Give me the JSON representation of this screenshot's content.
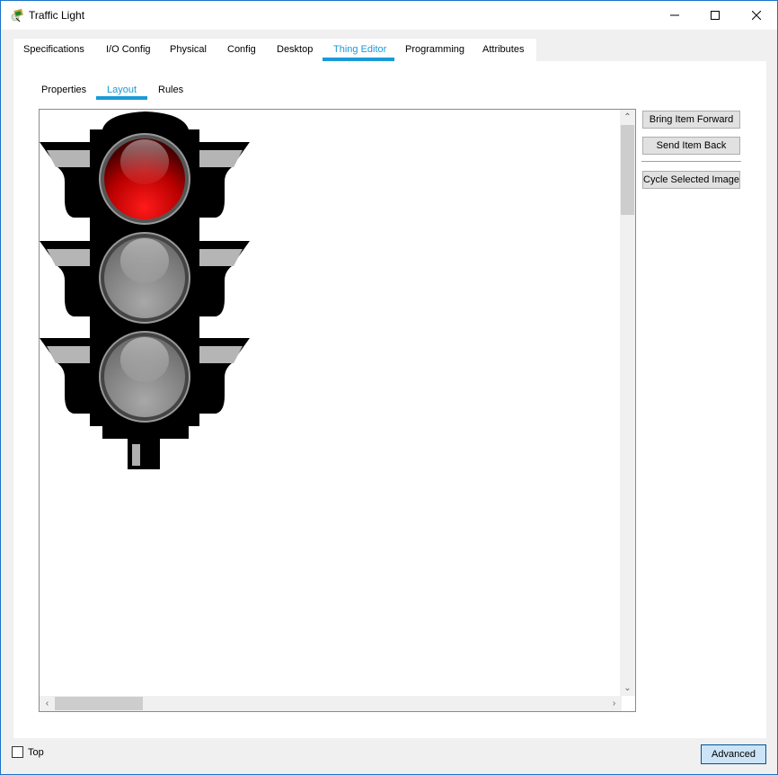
{
  "window": {
    "title": "Traffic Light",
    "controls": {
      "minimize": "minimize-icon",
      "maximize": "maximize-icon",
      "close": "close-icon"
    }
  },
  "tabs": [
    {
      "label": "Specifications",
      "active": false
    },
    {
      "label": "I/O Config",
      "active": false
    },
    {
      "label": "Physical",
      "active": false
    },
    {
      "label": "Config",
      "active": false
    },
    {
      "label": "Desktop",
      "active": false
    },
    {
      "label": "Thing Editor",
      "active": true
    },
    {
      "label": "Programming",
      "active": false
    },
    {
      "label": "Attributes",
      "active": false
    }
  ],
  "subtabs": [
    {
      "label": "Properties",
      "active": false
    },
    {
      "label": "Layout",
      "active": true
    },
    {
      "label": "Rules",
      "active": false
    }
  ],
  "canvas": {
    "image": "traffic-light",
    "lights": [
      {
        "name": "red",
        "state": "on",
        "color": "#e00000"
      },
      {
        "name": "yellow",
        "state": "off",
        "color": "#9a9a9a"
      },
      {
        "name": "green",
        "state": "off",
        "color": "#9a9a9a"
      }
    ]
  },
  "side_buttons": {
    "bring_forward": "Bring Item Forward",
    "send_back": "Send Item Back",
    "cycle_image": "Cycle Selected Image"
  },
  "footer": {
    "top_checkbox_label": "Top",
    "top_checked": false,
    "advanced_label": "Advanced"
  },
  "colors": {
    "accent": "#1a9ad6",
    "window_border": "#1a73c9"
  }
}
